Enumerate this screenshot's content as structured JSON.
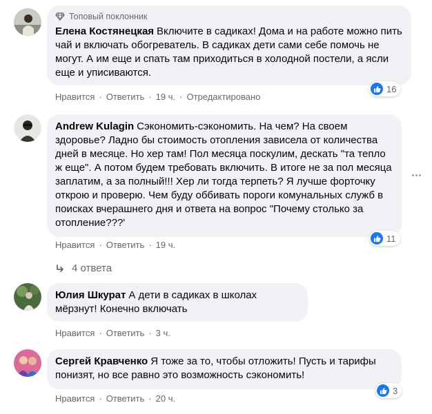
{
  "comments": [
    {
      "badge": "Топовый поклонник",
      "author": "Елена Костянецкая",
      "text": "Включите в садиках! Дома и на работе можно пить чай и включать обогреватель. В садиках дети сами себе помочь не могут. А им еще и спать там приходиться в холодной постели, а ясли еще и уписиваются.",
      "like_label": "Нравится",
      "reply_label": "Ответить",
      "time": "19 ч.",
      "edited": "Отредактировано",
      "reactions": "16"
    },
    {
      "author": "Andrew Kulagin",
      "text": "Сэкономить-сэкономить. На чем? На своем здоровье? Ладно бы стоимость отопления зависела от количества дней в месяце. Но хер там! Пол месяца поскулим, дескать \"та тепло ж еще\". А потом будем требовать включить. В итоге не за пол месяца заплатим, а за полный!!! Хер ли тогда терпеть? Я лучше форточку открою и проверю. Чем буду оббивать пороги комунальных служб в поисках вчерашнего дня и ответа на вопрос \"Почему столько за отопление???'",
      "like_label": "Нравится",
      "reply_label": "Ответить",
      "time": "19 ч.",
      "reactions": "11",
      "replies_label": "4 ответа"
    },
    {
      "author": "Юлия Шкурат",
      "text": "А дети в садиках в школах мёрзнут! Конечно включать",
      "like_label": "Нравится",
      "reply_label": "Ответить",
      "time": "3 ч."
    },
    {
      "author": "Сергей Кравченко",
      "text": "Я тоже за то, чтобы отложить! Пусть и тарифы понизят, но все равно это возможность сэкономить!",
      "like_label": "Нравится",
      "reply_label": "Ответить",
      "time": "20 ч.",
      "reactions": "3"
    }
  ],
  "colors": {
    "bubble": "#f0f2f5",
    "like_blue": "#1877f2",
    "meta_gray": "#65676b"
  },
  "icons": [
    "diamond-icon",
    "like-icon",
    "reply-arrow-icon",
    "more-options-icon"
  ]
}
